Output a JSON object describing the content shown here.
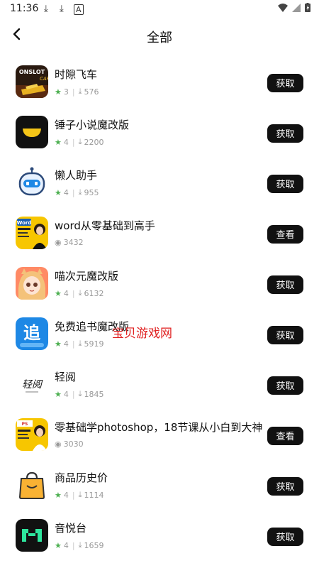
{
  "status": {
    "time": "11:36"
  },
  "header": {
    "title": "全部"
  },
  "apps": [
    {
      "name": "时隙飞车",
      "rating": "3",
      "metric": "576",
      "metric_type": "download",
      "button": "获取"
    },
    {
      "name": "锤子小说魔改版",
      "rating": "4",
      "metric": "2200",
      "metric_type": "download",
      "button": "获取"
    },
    {
      "name": "懒人助手",
      "rating": "4",
      "metric": "955",
      "metric_type": "download",
      "button": "获取"
    },
    {
      "name": "word从零基础到高手",
      "rating": "",
      "metric": "3432",
      "metric_type": "views",
      "button": "查看"
    },
    {
      "name": "喵次元魔改版",
      "rating": "4",
      "metric": "6132",
      "metric_type": "download",
      "button": "获取"
    },
    {
      "name": "免费追书魔改版",
      "rating": "4",
      "metric": "5919",
      "metric_type": "download",
      "button": "获取"
    },
    {
      "name": "轻阅",
      "rating": "4",
      "metric": "1845",
      "metric_type": "download",
      "button": "获取"
    },
    {
      "name": "零基础学photoshop，18节课从小白到大神",
      "rating": "",
      "metric": "3030",
      "metric_type": "views",
      "button": "查看"
    },
    {
      "name": "商品历史价",
      "rating": "4",
      "metric": "1114",
      "metric_type": "download",
      "button": "获取"
    },
    {
      "name": "音悦台",
      "rating": "4",
      "metric": "1659",
      "metric_type": "download",
      "button": "获取"
    }
  ],
  "icon_text": {
    "app1": "ONSLOT",
    "app6": "追",
    "app7": "轻阅",
    "app4": "Word",
    "app8": "PS"
  },
  "watermark": "宝贝游戏网"
}
